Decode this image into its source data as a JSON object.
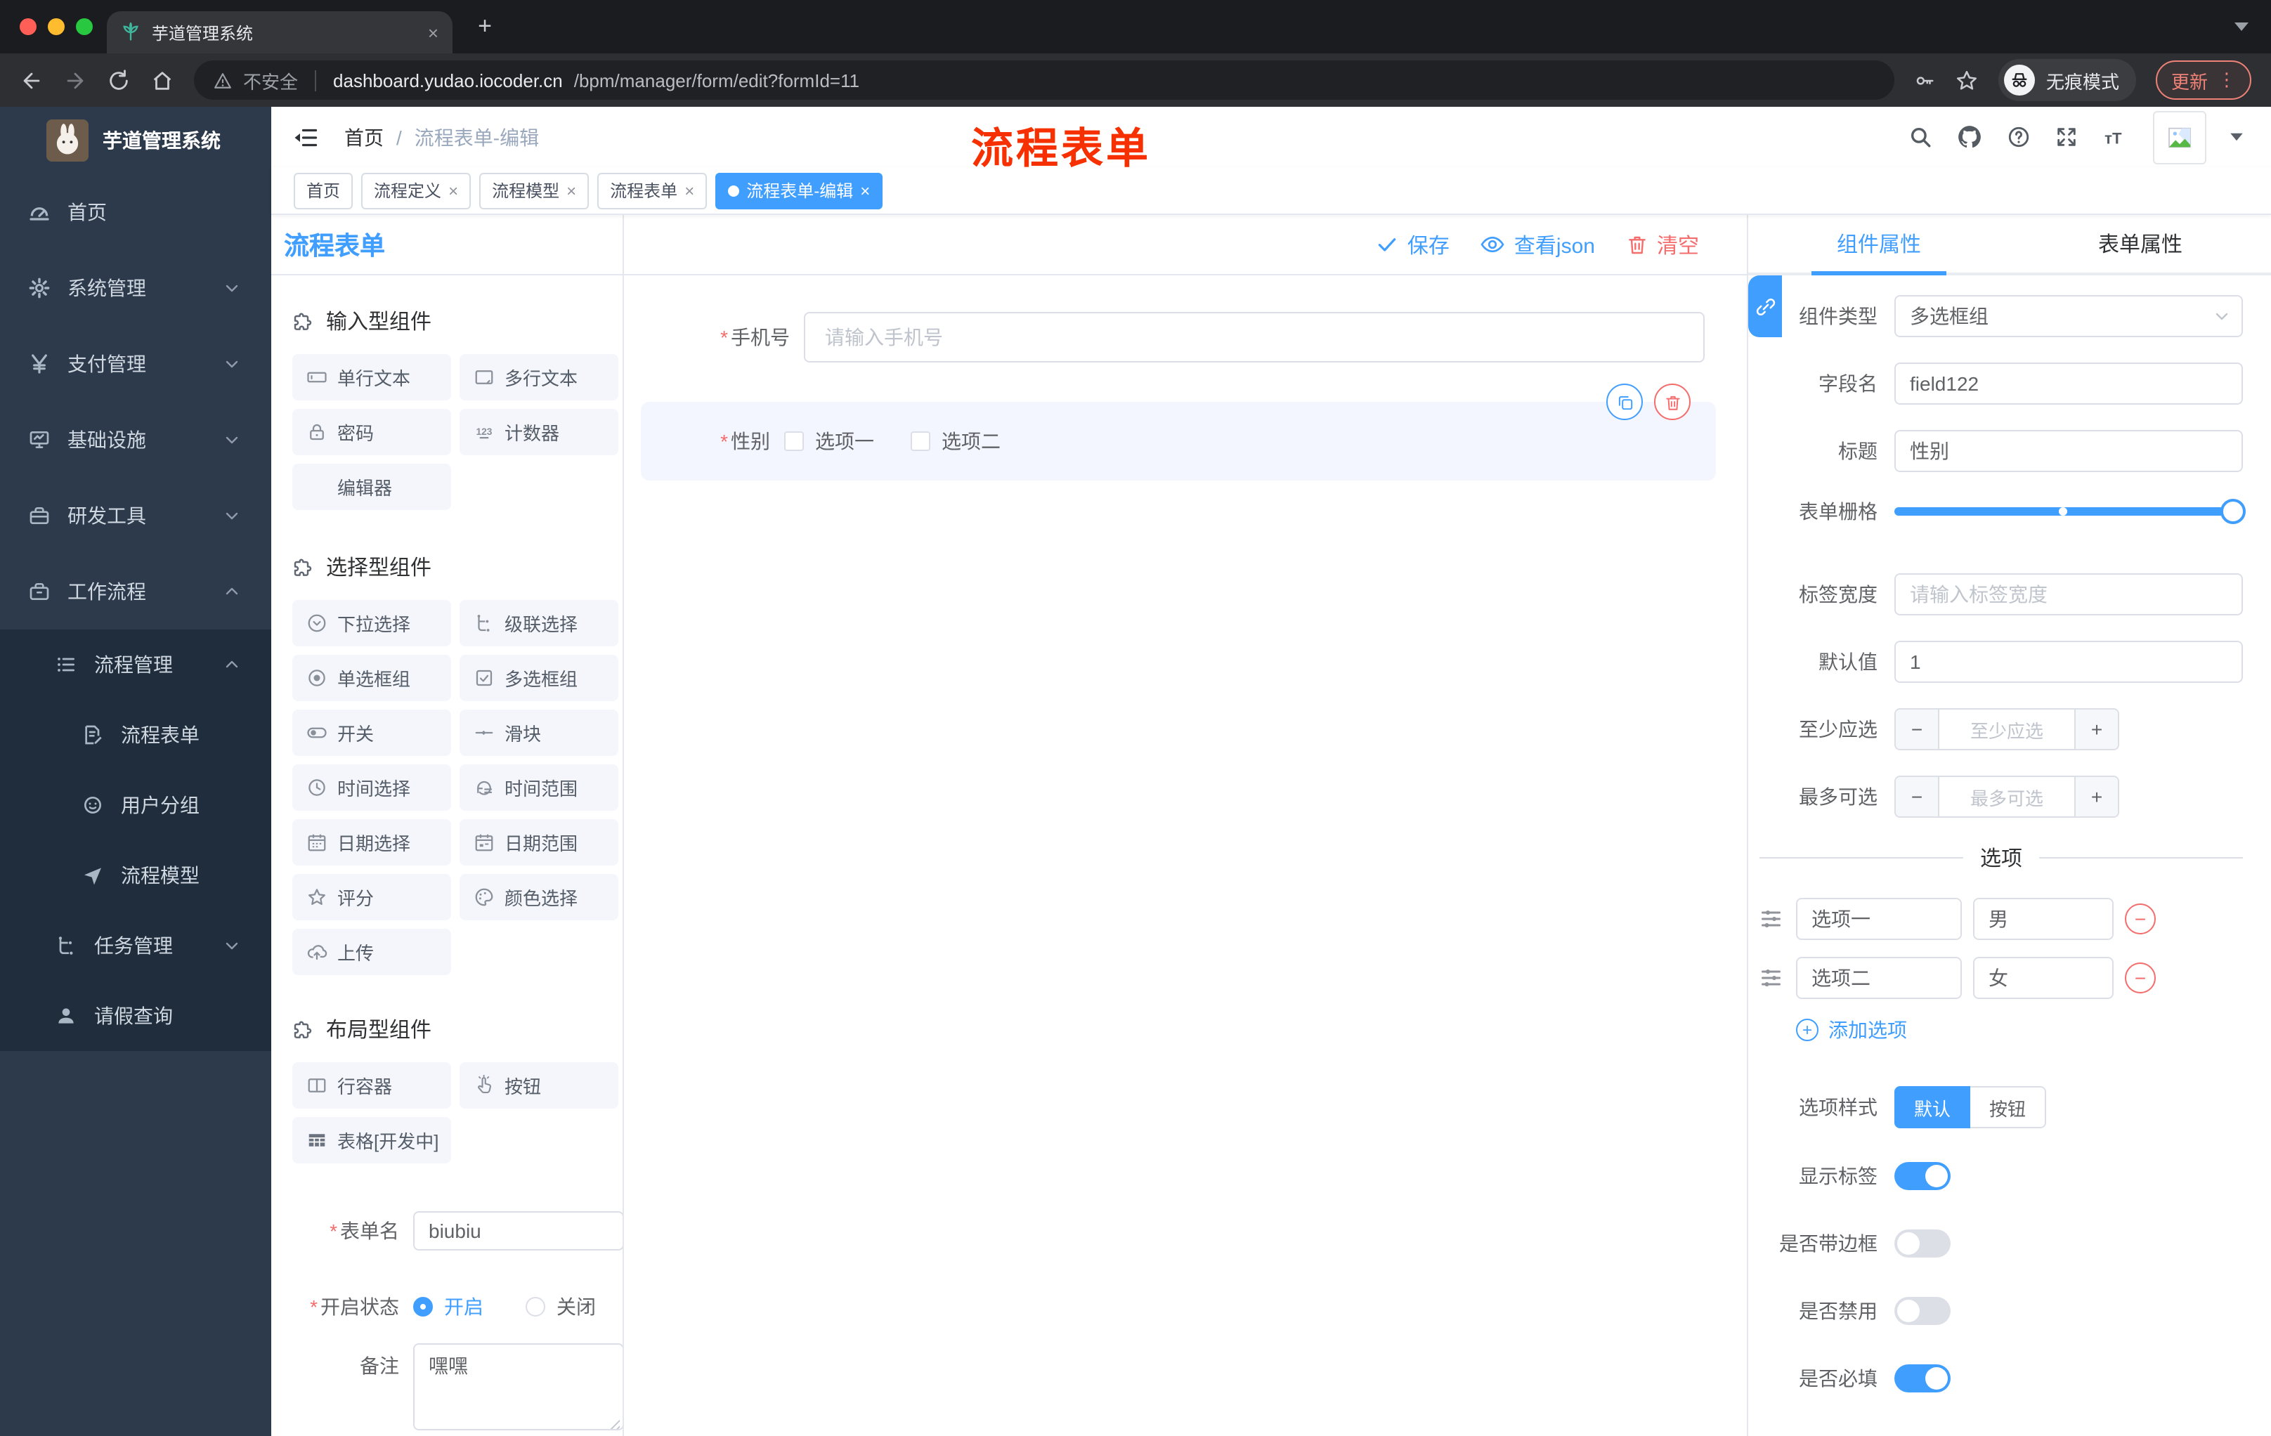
{
  "glyphs": {
    "close": "×",
    "plus": "+",
    "slash": "/",
    "asterisk": "*",
    "kebab": "⋮",
    "minus": "−"
  },
  "theme": {
    "accent": "#409eff",
    "danger": "#f56c6c",
    "annotation_red": "#f63000",
    "sidebar_bg": "#2d3a4b",
    "submenu_bg": "#1f2d3d"
  },
  "browser": {
    "tab_title": "芋道管理系统",
    "security_label": "不安全",
    "url_domain": "dashboard.yudao.iocoder.cn",
    "url_path": "/bpm/manager/form/edit?formId=11",
    "incognito_label": "无痕模式",
    "update_label": "更新"
  },
  "header": {
    "breadcrumb_home": "首页",
    "breadcrumb_current": "流程表单-编辑",
    "annotation": "流程表单"
  },
  "tags": {
    "items": [
      {
        "label": "首页",
        "closable": false,
        "active": false
      },
      {
        "label": "流程定义",
        "closable": true,
        "active": false
      },
      {
        "label": "流程模型",
        "closable": true,
        "active": false
      },
      {
        "label": "流程表单",
        "closable": true,
        "active": false
      },
      {
        "label": "流程表单-编辑",
        "closable": true,
        "active": true
      }
    ]
  },
  "sidebar": {
    "app_title": "芋道管理系统",
    "items": [
      {
        "label": "首页",
        "icon": "dashboard-icon"
      },
      {
        "label": "系统管理",
        "icon": "gear-icon",
        "arrow": "down"
      },
      {
        "label": "支付管理",
        "icon": "yen-icon",
        "arrow": "down"
      },
      {
        "label": "基础设施",
        "icon": "monitor-icon",
        "arrow": "down"
      },
      {
        "label": "研发工具",
        "icon": "toolbox-icon",
        "arrow": "down"
      },
      {
        "label": "工作流程",
        "icon": "briefcase-icon",
        "arrow": "up"
      }
    ],
    "sub_items": [
      {
        "label": "流程管理",
        "icon": "list-icon",
        "arrow": "up"
      },
      {
        "label": "流程表单",
        "icon": "form-icon"
      },
      {
        "label": "用户分组",
        "icon": "group-icon"
      },
      {
        "label": "流程模型",
        "icon": "model-icon"
      },
      {
        "label": "任务管理",
        "icon": "tasks-icon",
        "arrow": "down"
      },
      {
        "label": "请假查询",
        "icon": "user-icon"
      }
    ]
  },
  "palette": {
    "title": "流程表单",
    "groups": [
      {
        "title": "输入型组件",
        "items": [
          {
            "label": "单行文本",
            "icon": "input-icon"
          },
          {
            "label": "多行文本",
            "icon": "textarea-icon"
          },
          {
            "label": "密码",
            "icon": "lock-icon"
          },
          {
            "label": "计数器",
            "icon": "counter-icon"
          },
          {
            "label": "编辑器",
            "icon": ""
          }
        ]
      },
      {
        "title": "选择型组件",
        "items": [
          {
            "label": "下拉选择",
            "icon": "select-icon"
          },
          {
            "label": "级联选择",
            "icon": "cascade-icon"
          },
          {
            "label": "单选框组",
            "icon": "radio-icon"
          },
          {
            "label": "多选框组",
            "icon": "checkbox-icon"
          },
          {
            "label": "开关",
            "icon": "switch-icon"
          },
          {
            "label": "滑块",
            "icon": "slider-icon"
          },
          {
            "label": "时间选择",
            "icon": "time-icon"
          },
          {
            "label": "时间范围",
            "icon": "time-range-icon"
          },
          {
            "label": "日期选择",
            "icon": "date-icon"
          },
          {
            "label": "日期范围",
            "icon": "date-range-icon"
          },
          {
            "label": "评分",
            "icon": "rate-icon"
          },
          {
            "label": "颜色选择",
            "icon": "color-icon"
          },
          {
            "label": "上传",
            "icon": "upload-icon"
          }
        ]
      },
      {
        "title": "布局型组件",
        "items": [
          {
            "label": "行容器",
            "icon": "row-icon"
          },
          {
            "label": "按钮",
            "icon": "button-icon"
          },
          {
            "label": "表格[开发中]",
            "icon": "table-icon"
          }
        ]
      }
    ],
    "form": {
      "name_label": "表单名",
      "name_value": "biubiu",
      "status_label": "开启状态",
      "status_on": "开启",
      "status_off": "关闭",
      "remark_label": "备注",
      "remark_value": "嘿嘿"
    }
  },
  "canvas": {
    "toolbar": {
      "save": "保存",
      "view_json": "查看json",
      "clear": "清空"
    },
    "phone": {
      "label": "手机号",
      "placeholder": "请输入手机号"
    },
    "gender": {
      "label": "性别",
      "option1": "选项一",
      "option2": "选项二"
    }
  },
  "panel": {
    "tab_component": "组件属性",
    "tab_form": "表单属性",
    "rows": {
      "type_label": "组件类型",
      "type_value": "多选框组",
      "field_label": "字段名",
      "field_value": "field122",
      "title_label": "标题",
      "title_value": "性别",
      "grid_label": "表单栅格",
      "width_label": "标签宽度",
      "width_placeholder": "请输入标签宽度",
      "default_label": "默认值",
      "default_value": "1",
      "min_label": "至少应选",
      "min_placeholder": "至少应选",
      "max_label": "最多可选",
      "max_placeholder": "最多可选",
      "options_divider": "选项",
      "option1_name": "选项一",
      "option1_value": "男",
      "option2_name": "选项二",
      "option2_value": "女",
      "add_option": "添加选项",
      "style_label": "选项样式",
      "style_default": "默认",
      "style_button": "按钮",
      "show_label": "显示标签",
      "border_label": "是否带边框",
      "disabled_label": "是否禁用",
      "required_label": "是否必填"
    }
  }
}
